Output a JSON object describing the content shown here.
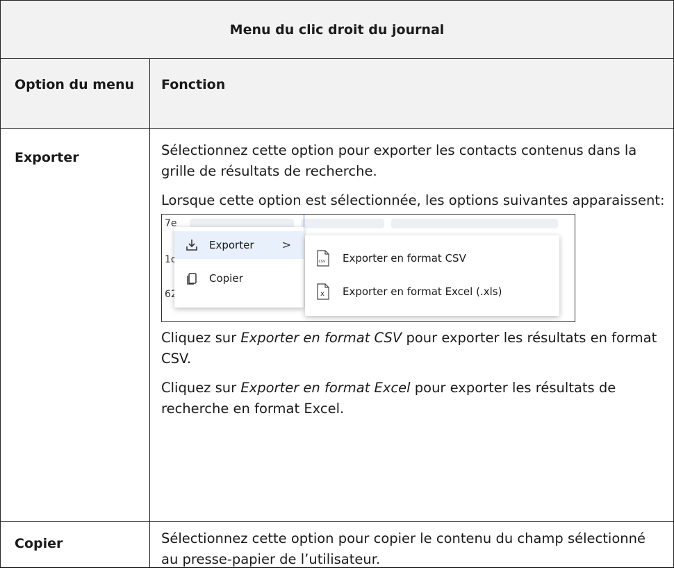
{
  "table": {
    "title": "Menu du clic droit du journal",
    "headers": {
      "option": "Option du menu",
      "function": "Fonction"
    },
    "rows": [
      {
        "option": "Exporter",
        "p1": "Sélectionnez cette option pour exporter les contacts contenus dans la grille de résultats de recherche.",
        "p2": "Lorsque cette option est sélectionnée, les options suivantes apparaissent:",
        "p3_pre": "Cliquez sur ",
        "p3_em": "Exporter en format CSV",
        "p3_post": " pour exporter les résultats en format CSV.",
        "p4_pre": "Cliquez sur ",
        "p4_em": "Exporter en format Excel",
        "p4_post": " pour exporter les résultats de recherche en format Excel."
      },
      {
        "option": "Copier",
        "p1": "Sélectionnez cette option pour copier le contenu du champ sélectionné au presse-papier de l’utilisateur."
      }
    ]
  },
  "screenshot": {
    "row_fragments": [
      "7e",
      "1c",
      "62"
    ],
    "main_menu": [
      {
        "label": "Exporter",
        "icon": "download-icon",
        "chevron": ">"
      },
      {
        "label": "Copier",
        "icon": "copy-icon"
      }
    ],
    "submenu": [
      {
        "label": "Exporter en format CSV",
        "icon": "csv-file-icon",
        "icon_text": "csv"
      },
      {
        "label": "Exporter en format Excel (.xls)",
        "icon": "excel-file-icon",
        "icon_text": "x"
      }
    ],
    "colors": {
      "active_item": "#e8f0fb",
      "border": "#222222",
      "header_bg": "#f2f2f2"
    }
  }
}
